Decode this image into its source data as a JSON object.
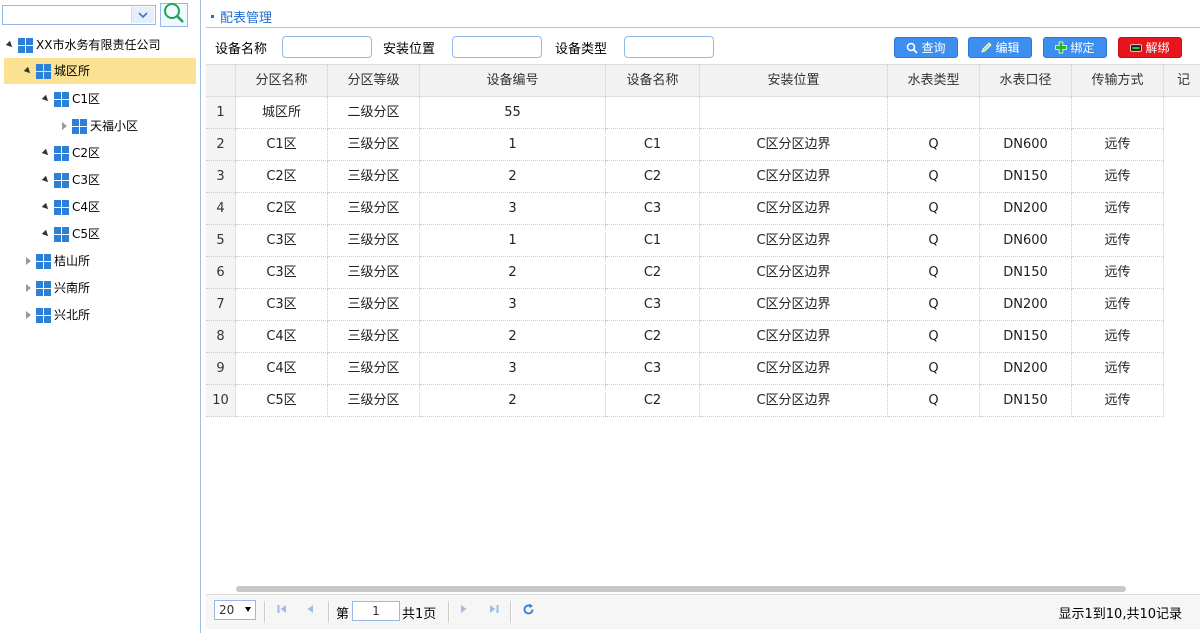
{
  "tree": {
    "search_value": "",
    "nodes": [
      {
        "label": "XX市水务有限责任公司",
        "state": "open"
      },
      {
        "label": "城区所",
        "state": "open",
        "selected": true
      },
      {
        "label": "C1区",
        "state": "open"
      },
      {
        "label": "天福小区",
        "state": "closed"
      },
      {
        "label": "C2区",
        "state": "open"
      },
      {
        "label": "C3区",
        "state": "open"
      },
      {
        "label": "C4区",
        "state": "open"
      },
      {
        "label": "C5区",
        "state": "open"
      },
      {
        "label": "桔山所",
        "state": "closed"
      },
      {
        "label": "兴南所",
        "state": "closed"
      },
      {
        "label": "兴北所",
        "state": "closed"
      }
    ]
  },
  "panel": {
    "title": "配表管理"
  },
  "filters": {
    "device_name_label": "设备名称",
    "install_location_label": "安装位置",
    "device_type_label": "设备类型",
    "device_name_value": "",
    "install_location_value": "",
    "device_type_value": ""
  },
  "toolbar": {
    "query_label": "查询",
    "edit_label": "编辑",
    "bind_label": "绑定",
    "unbind_label": "解绑"
  },
  "colors": {
    "accent": "#1f6ed4",
    "button_blue": "#3e8ef0",
    "button_red": "#e8151c",
    "selected_row": "#fbe192"
  },
  "grid": {
    "columns": [
      "分区名称",
      "分区等级",
      "设备编号",
      "设备名称",
      "安装位置",
      "水表类型",
      "水表口径",
      "传输方式",
      "记"
    ],
    "rows": [
      [
        "1",
        "城区所",
        "二级分区",
        "55",
        "",
        "",
        "",
        "",
        ""
      ],
      [
        "2",
        "C1区",
        "三级分区",
        "1",
        "C1",
        "C区分区边界",
        "Q",
        "DN600",
        "远传"
      ],
      [
        "3",
        "C2区",
        "三级分区",
        "2",
        "C2",
        "C区分区边界",
        "Q",
        "DN150",
        "远传"
      ],
      [
        "4",
        "C2区",
        "三级分区",
        "3",
        "C3",
        "C区分区边界",
        "Q",
        "DN200",
        "远传"
      ],
      [
        "5",
        "C3区",
        "三级分区",
        "1",
        "C1",
        "C区分区边界",
        "Q",
        "DN600",
        "远传"
      ],
      [
        "6",
        "C3区",
        "三级分区",
        "2",
        "C2",
        "C区分区边界",
        "Q",
        "DN150",
        "远传"
      ],
      [
        "7",
        "C3区",
        "三级分区",
        "3",
        "C3",
        "C区分区边界",
        "Q",
        "DN200",
        "远传"
      ],
      [
        "8",
        "C4区",
        "三级分区",
        "2",
        "C2",
        "C区分区边界",
        "Q",
        "DN150",
        "远传"
      ],
      [
        "9",
        "C4区",
        "三级分区",
        "3",
        "C3",
        "C区分区边界",
        "Q",
        "DN200",
        "远传"
      ],
      [
        "10",
        "C5区",
        "三级分区",
        "2",
        "C2",
        "C区分区边界",
        "Q",
        "DN150",
        "远传"
      ]
    ]
  },
  "pager": {
    "page_size": "20",
    "page_prefix": "第",
    "page_value": "1",
    "page_suffix": "共1页",
    "info": "显示1到10,共10记录"
  }
}
